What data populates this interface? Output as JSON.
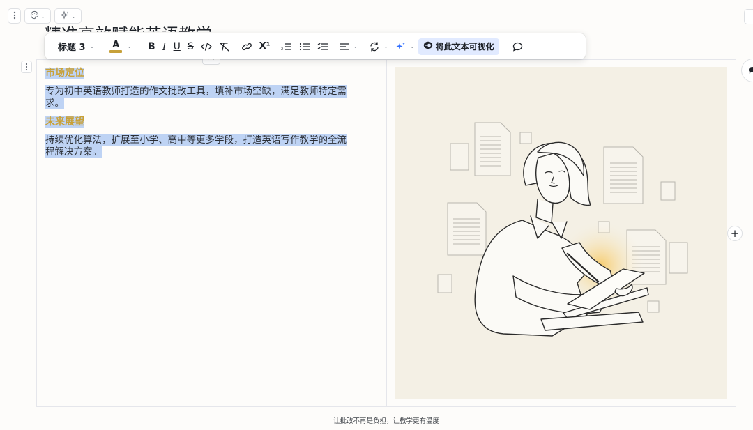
{
  "document": {
    "title_partial": "精准高效赋能英语教学"
  },
  "toolbar": {
    "heading_label": "标题 3",
    "text_color_label": "A",
    "bold_label": "B",
    "italic_label": "I",
    "underline_label": "U",
    "strike_label": "S",
    "superscript_label": "X¹",
    "visualize_label": "将此文本可视化",
    "text_color_hex": "#c7a13a",
    "highlight_bg": "#e1eaff"
  },
  "content": {
    "blocks": [
      {
        "type": "heading3",
        "text": "市场定位"
      },
      {
        "type": "paragraph",
        "lines": [
          "专为初中英语教师打造的作文批改工具，填补市场空缺，满足教师特定需",
          "求。"
        ]
      },
      {
        "type": "heading3",
        "text": "未来展望"
      },
      {
        "type": "paragraph",
        "lines": [
          "持续优化算法，扩展至小学、高中等更多学段，打造英语写作教学的全流",
          "程解决方案。"
        ]
      }
    ],
    "heading_color": "#c9a136",
    "selection_color": "#bed3f4"
  },
  "illustration": {
    "subject": "woman-writing-on-tablet-with-documents",
    "background": "#f4f0e5"
  },
  "footer": {
    "caption": "让批改不再是负担，让教学更有温度"
  },
  "icons": {
    "menu": "vertical-dots-icon",
    "theme": "palette-icon",
    "ai": "sparkle-icon",
    "link": "link-icon",
    "code": "code-icon",
    "clear_format": "clear-format-icon",
    "ordered_list": "ordered-list-icon",
    "bullet_list": "bullet-list-icon",
    "task_list": "task-list-icon",
    "align": "align-left-icon",
    "convert": "convert-icon",
    "comment": "comment-icon",
    "add": "plus-icon"
  }
}
